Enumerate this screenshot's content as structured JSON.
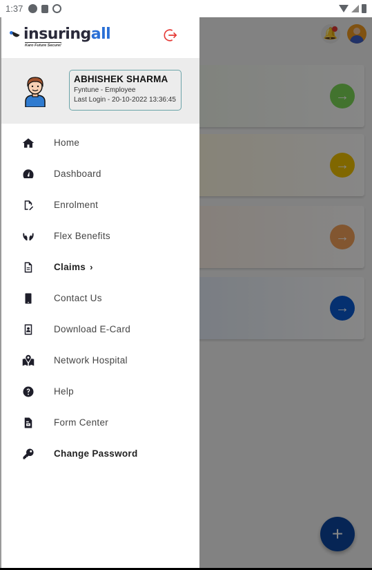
{
  "status_bar": {
    "time": "1:37",
    "left_icons": [
      "app-notification-icon",
      "sd-card-icon",
      "sync-disabled-icon"
    ],
    "right_icons": [
      "wifi-icon",
      "cell-signal-icon",
      "battery-icon"
    ]
  },
  "drawer": {
    "logo": {
      "brand_main": "insuring",
      "brand_accent": "all",
      "tagline": "Karo Future Secure!"
    },
    "logout_icon": "logout-icon",
    "profile": {
      "name": "ABHISHEK SHARMA",
      "role": "Fyntune - Employee",
      "last_login": "Last Login - 20-10-2022 13:36:45"
    },
    "menu": [
      {
        "label": "Home",
        "icon": "home-icon",
        "bold": false
      },
      {
        "label": "Dashboard",
        "icon": "dashboard-gauge-icon",
        "bold": false
      },
      {
        "label": "Enrolment",
        "icon": "file-edit-icon",
        "bold": false
      },
      {
        "label": "Flex Benefits",
        "icon": "hands-icon",
        "bold": false
      },
      {
        "label": "Claims",
        "icon": "document-icon",
        "bold": true,
        "chevron": "›"
      },
      {
        "label": "Contact Us",
        "icon": "mobile-phone-icon",
        "bold": false
      },
      {
        "label": "Download E-Card",
        "icon": "id-card-icon",
        "bold": false
      },
      {
        "label": "Network Hospital",
        "icon": "map-pin-icon",
        "bold": false
      },
      {
        "label": "Help",
        "icon": "question-circle-icon",
        "bold": false
      },
      {
        "label": "Form Center",
        "icon": "form-document-icon",
        "bold": false
      },
      {
        "label": "Change Password",
        "icon": "key-icon",
        "bold": true
      }
    ]
  },
  "background": {
    "cards": [
      {
        "accent": "#7ed957",
        "bg": "#f1f7ec"
      },
      {
        "accent": "#f2c300",
        "bg": "#fff8e0"
      },
      {
        "accent": "#f5a35c",
        "bg": "#fdf0e6"
      },
      {
        "accent": "#0a5bd3",
        "bg": "#e4ecf8"
      }
    ],
    "fab_label": "+",
    "card_arrow": "→"
  },
  "colors": {
    "brand_blue": "#2a6fd6",
    "logout_red": "#e53935",
    "profile_border": "#6aa3a8"
  }
}
